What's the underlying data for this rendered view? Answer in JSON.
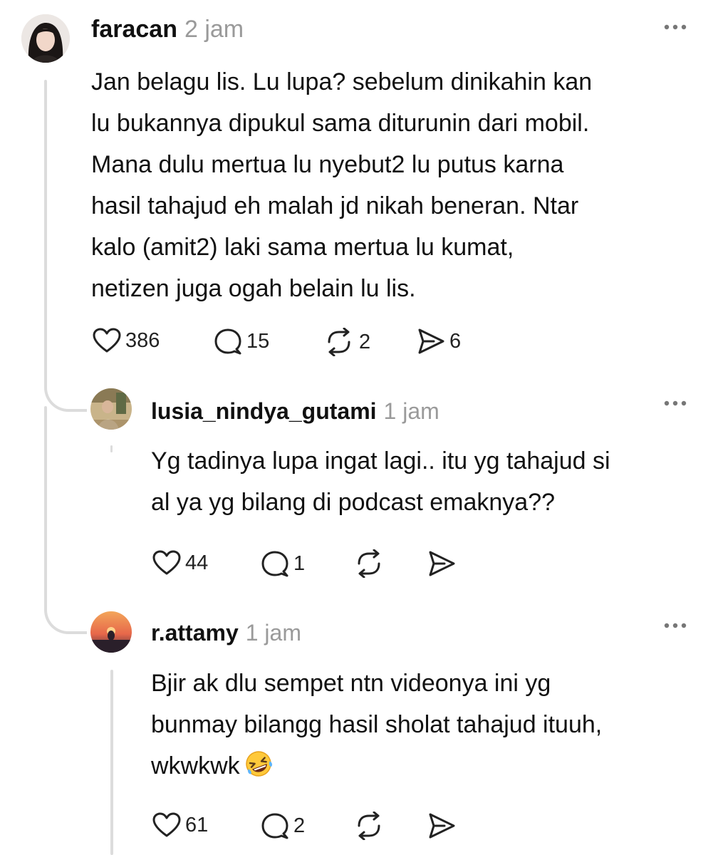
{
  "comments": [
    {
      "username": "faracan",
      "time": "2 jam",
      "lines": [
        "Jan belagu lis. Lu lupa? sebelum dinikahin kan",
        "lu bukannya dipukul sama diturunin dari mobil.",
        "Mana dulu mertua lu nyebut2 lu putus karna",
        "hasil tahajud eh malah jd nikah beneran. Ntar",
        "kalo (amit2) laki sama mertua lu kumat,",
        "netizen juga ogah belain lu lis."
      ],
      "likes": "386",
      "replies": "15",
      "reposts": "2",
      "shares": "6"
    },
    {
      "username": "lusia_nindya_gutami",
      "time": "1 jam",
      "lines": [
        "Yg tadinya lupa ingat lagi.. itu yg tahajud si",
        "al ya yg bilang di podcast emaknya??"
      ],
      "likes": "44",
      "replies": "1"
    },
    {
      "username": "r.attamy",
      "time": "1 jam",
      "lines": [
        "Bjir ak dlu sempet ntn videonya ini yg",
        "bunmay bilangg hasil sholat tahajud ituuh,",
        "wkwkwk"
      ],
      "emoji": "rolling-on-floor-laughing-emoji",
      "likes": "61",
      "replies": "2"
    }
  ],
  "colors": {
    "text": "#111111",
    "muted": "#9a9a9a",
    "thread_line": "#dcdcdc"
  }
}
